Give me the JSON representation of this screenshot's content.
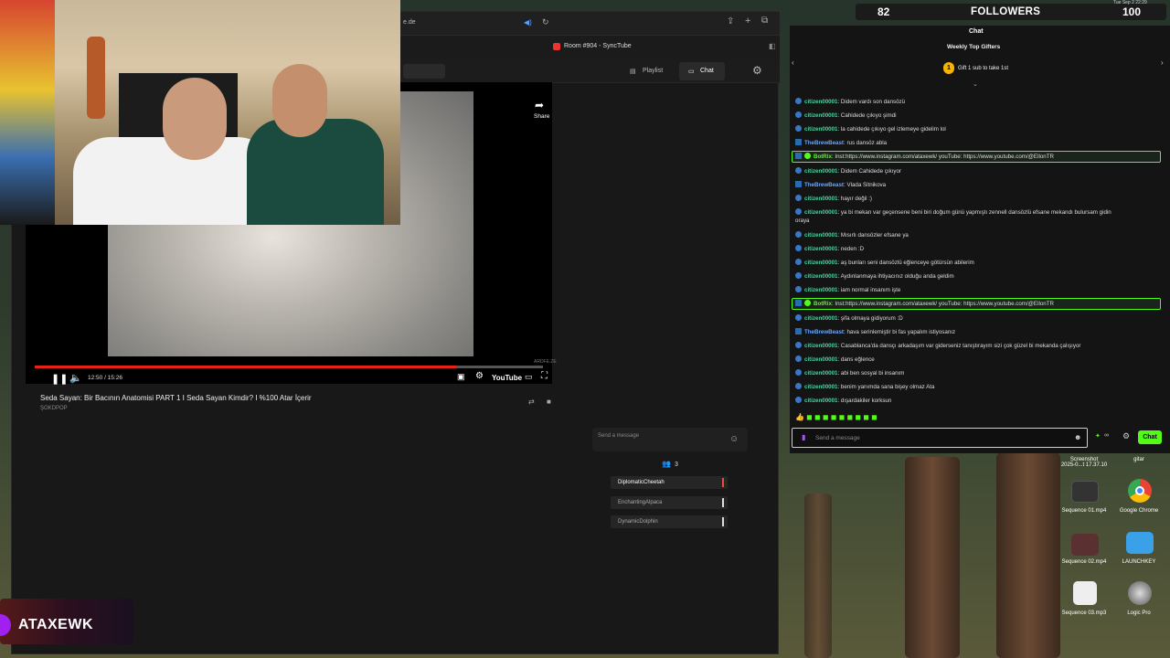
{
  "browser": {
    "url_fragment": "e.de",
    "tab_title": "Room #904 - SyncTube"
  },
  "synctube": {
    "tabs": [
      {
        "label": "Playlist"
      },
      {
        "label": "Chat"
      }
    ],
    "share_label": "Share",
    "player": {
      "time_display": "12:50 / 15:26",
      "progress": 0.83,
      "youtube_label": "YouTube",
      "watermark": "ARDFE.ZE"
    },
    "video_title": "Seda Sayan: Bir Bacının Anatomisi PART 1 I Seda Sayan Kimdir? I %100 Atar İçerir",
    "channel_name": "ŞOKDPOP",
    "send_placeholder": "Send a message",
    "member_count": "3",
    "members": [
      {
        "name": "DiplomaticCheetah",
        "color": "#e74c3c"
      },
      {
        "name": "EnchantingAlpaca",
        "color": "#dddddd"
      },
      {
        "name": "DynamicDolphin",
        "color": "#dddddd"
      }
    ]
  },
  "overlay": {
    "followers_current": "82",
    "followers_label": "FOLLOWERS",
    "followers_goal": "100",
    "clock": "Tue Sep 2  22:29"
  },
  "kick": {
    "header": "Chat",
    "gifters_title": "Weekly Top Gifters",
    "gift_cta": "Gift 1 sub to take 1st",
    "gift_count": "1",
    "messages": [
      {
        "user": "citizen00001",
        "kind": "u",
        "text": "Didem vardı son dansözü"
      },
      {
        "user": "citizen00001",
        "kind": "u",
        "text": "Cahidede çıkıyo şimdi"
      },
      {
        "user": "citizen00001",
        "kind": "u",
        "text": "la cahidede çıkıyo gel izlemeye gidelim lol"
      },
      {
        "user": "TheBrewBeast",
        "kind": "tb",
        "text": "rus dansöz abla"
      },
      {
        "user": "BotRix",
        "kind": "bot",
        "text": "Inst:https://www.instagram.com/ataxewk/ youTube: https://www.youtube.com/@EllonTR"
      },
      {
        "user": "citizen00001",
        "kind": "u",
        "text": "Didem Cahidede çıkıyor"
      },
      {
        "user": "TheBrewBeast",
        "kind": "tb",
        "text": "Vlada Sitnikova"
      },
      {
        "user": "citizen00001",
        "kind": "u",
        "text": "hayır değil :)"
      },
      {
        "user": "citizen00001",
        "kind": "u",
        "text": "ya bi mekan var geçensene beni biri doğum günü yapmıştı zennell dansözlü efsane mekandı bulursam gidin"
      },
      {
        "user": "",
        "kind": "cont",
        "text": "oraya"
      },
      {
        "user": "citizen00001",
        "kind": "u",
        "text": "Mısırlı dansözler efsane ya"
      },
      {
        "user": "citizen00001",
        "kind": "u",
        "text": "neden :D"
      },
      {
        "user": "citizen00001",
        "kind": "u",
        "text": "aş bunları seni dansözlü eğlenceye götürsün abilerim"
      },
      {
        "user": "citizen00001",
        "kind": "u",
        "text": "Aydınlanmaya ihtiyacınız olduğu anda geldim"
      },
      {
        "user": "citizen00001",
        "kind": "u",
        "text": "iam normal insanım işte"
      },
      {
        "user": "BotRix",
        "kind": "bot",
        "text": "Inst:https://www.instagram.com/ataxewk/ youTube: https://www.youtube.com/@EllonTR"
      },
      {
        "user": "citizen00001",
        "kind": "u",
        "text": "şifa olmaya gidiyorum :D"
      },
      {
        "user": "TheBrewBeast",
        "kind": "tb",
        "text": "hava serinlemiştir bi fas yapalım istiyosanız"
      },
      {
        "user": "citizen00001",
        "kind": "u",
        "text": "Casablanca'da dansçı arkadaşım var giderseniz tanıştırayım sizi çok güzel bi mekanda çalışıyor"
      },
      {
        "user": "citizen00001",
        "kind": "u",
        "text": "dans eğlence"
      },
      {
        "user": "citizen00001",
        "kind": "u",
        "text": "abi ben sosyal bi insanım"
      },
      {
        "user": "citizen00001",
        "kind": "u",
        "text": "benim yanımda sana bişey olmaz Ata"
      },
      {
        "user": "citizen00001",
        "kind": "u",
        "text": "dışardakiler korksun"
      }
    ],
    "input_placeholder": "Send a message",
    "chat_button": "Chat",
    "emote_count_label": "∞"
  },
  "desktop": {
    "icons": [
      {
        "label": "Screenshot\n2025-0...t 17.37.10",
        "name": "screenshot-file-icon"
      },
      {
        "label": "gitar",
        "name": "folder-gitar-icon"
      },
      {
        "label": "Sequence 01.mp4",
        "name": "video-file-icon"
      },
      {
        "label": "Google Chrome",
        "name": "chrome-icon"
      },
      {
        "label": "Sequence 02.mp4",
        "name": "video-file-icon"
      },
      {
        "label": "LAUNCHKEY",
        "name": "folder-icon"
      },
      {
        "label": "Sequence 03.mp3",
        "name": "audio-file-icon"
      },
      {
        "label": "Logic Pro",
        "name": "logic-pro-icon"
      }
    ]
  },
  "streamer": {
    "logo_text": "ATAXEWK"
  }
}
